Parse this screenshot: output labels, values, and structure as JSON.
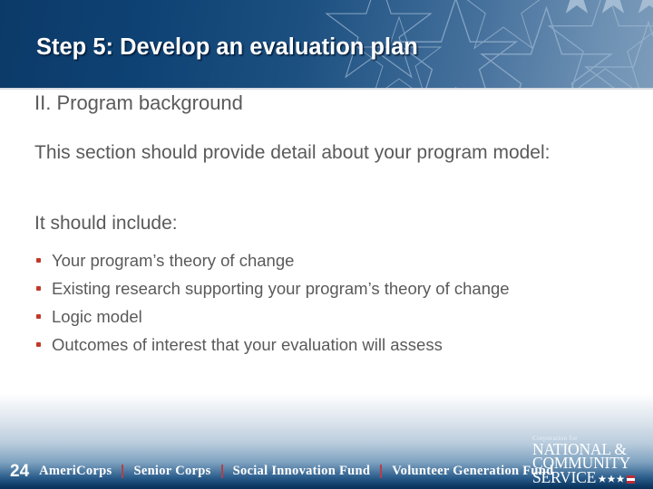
{
  "slide": {
    "title": "Step 5: Develop an evaluation plan",
    "section_heading": "II. Program background",
    "paragraph": "This section should provide detail about your program model:",
    "include_line": "It should include:",
    "bullets": [
      "Your program’s theory of change",
      "Existing research supporting your program’s theory of change",
      "Logic model",
      "Outcomes of interest that your evaluation will assess"
    ]
  },
  "footer": {
    "page_number": "24",
    "brands": [
      "AmeriCorps",
      "Senior Corps",
      "Social Innovation Fund",
      "Volunteer Generation Fund"
    ],
    "logo": {
      "eyebrow": "Corporation for",
      "line1": "NATIONAL &",
      "line2": "COMMUNITY",
      "line3": "SERVICE"
    }
  },
  "colors": {
    "header_dark": "#0c3a68",
    "header_light": "#7d9cbb",
    "body_text": "#5a5a5a",
    "bullet_red": "#c0392b",
    "separator_red": "#b4404a",
    "footer_dark": "#0a3156",
    "white": "#ffffff"
  }
}
